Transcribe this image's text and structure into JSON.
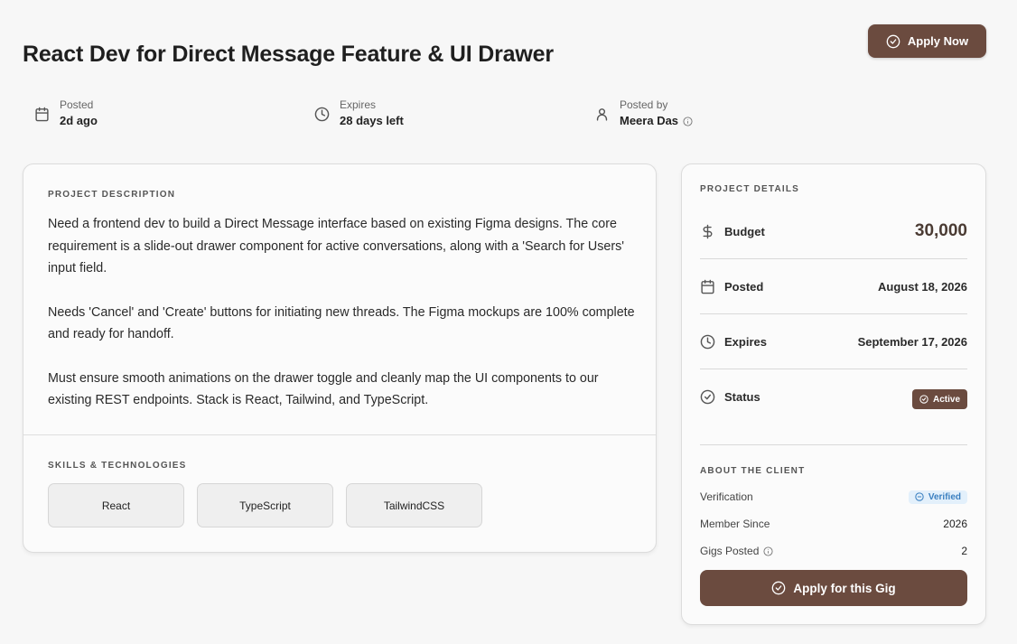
{
  "header": {
    "title": "React Dev for Direct Message Feature & UI Drawer",
    "apply_now_label": "Apply Now"
  },
  "meta": {
    "posted": {
      "label": "Posted",
      "value": "2d ago",
      "icon": "calendar-icon"
    },
    "expires": {
      "label": "Expires",
      "value": "28 days left",
      "icon": "clock-icon"
    },
    "posted_by": {
      "label": "Posted by",
      "value": "Meera Das",
      "icon": "user-icon"
    }
  },
  "description": {
    "section_label": "PROJECT DESCRIPTION",
    "paragraphs": [
      "Need a frontend dev to build a Direct Message interface based on existing Figma designs. The core requirement is a slide-out drawer component for active conversations, along with a 'Search for Users' input field.",
      "Needs 'Cancel' and 'Create' buttons for initiating new threads. The Figma mockups are 100% complete and ready for handoff.",
      "Must ensure smooth animations on the drawer toggle and cleanly map the UI components to our existing REST endpoints. Stack is React, Tailwind, and TypeScript."
    ],
    "skills_label": "SKILLS & TECHNOLOGIES",
    "skills": [
      "React",
      "TypeScript",
      "TailwindCSS"
    ]
  },
  "details": {
    "section_label": "PROJECT DETAILS",
    "budget": {
      "label": "Budget",
      "value": "30,000"
    },
    "posted": {
      "label": "Posted",
      "value": "August 18, 2026"
    },
    "expires": {
      "label": "Expires",
      "value": "September 17, 2026"
    },
    "status": {
      "label": "Status",
      "value": "Active"
    }
  },
  "client": {
    "section_label": "ABOUT THE CLIENT",
    "verification": {
      "label": "Verification",
      "value": "Verified"
    },
    "member_since": {
      "label": "Member Since",
      "value": "2026"
    },
    "gigs_posted": {
      "label": "Gigs Posted",
      "value": "2"
    },
    "apply_label": "Apply for this Gig"
  },
  "colors": {
    "accent": "#6b4b3f",
    "verified_bg": "#e3f0fb",
    "verified_text": "#3a7fc0"
  }
}
